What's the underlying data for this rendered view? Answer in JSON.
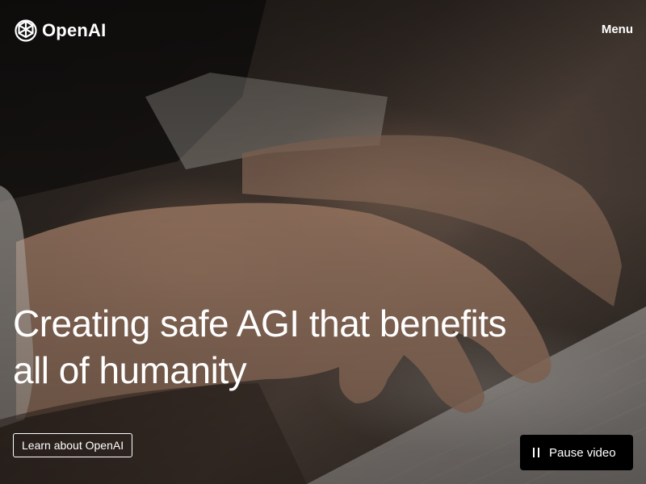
{
  "brand": {
    "name": "OpenAI",
    "logo_icon": "openai-knot-icon"
  },
  "nav": {
    "menu_label": "Menu"
  },
  "hero": {
    "headline_line1": "Creating safe AGI that benefits",
    "headline_line2": "all of humanity",
    "cta_label": "Learn about OpenAI",
    "background_video": "hands typing on keyboard"
  },
  "video_controls": {
    "pause_label": "Pause video",
    "pause_icon": "pause-icon"
  },
  "colors": {
    "text": "#ffffff",
    "button_bg": "#000000"
  }
}
